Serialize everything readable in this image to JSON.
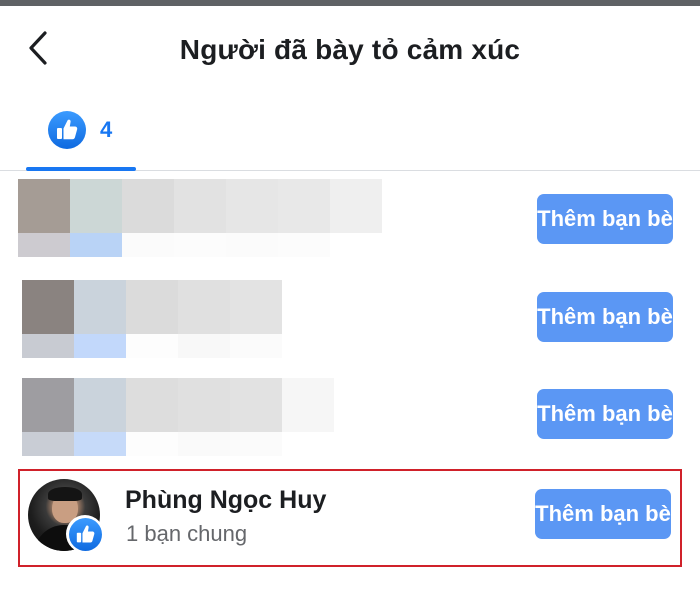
{
  "header": {
    "title": "Người đã bày tỏ cảm xúc",
    "back_icon": "arrow-back-icon"
  },
  "tabs": {
    "like_tab": {
      "icon": "like-icon",
      "count": "4",
      "active": true
    }
  },
  "list": {
    "rows": [
      {
        "name": "",
        "obscured": true,
        "action_label": "Thêm bạn bè"
      },
      {
        "name": "",
        "obscured": true,
        "action_label": "Thêm bạn bè"
      },
      {
        "name": "",
        "obscured": true,
        "action_label": "Thêm bạn bè"
      },
      {
        "name": "Phùng Ngọc Huy",
        "subtitle": "1 bạn chung",
        "reaction": "like",
        "highlighted": true,
        "action_label": "Thêm bạn bè"
      }
    ]
  },
  "colors": {
    "accent": "#1877f2",
    "button": "#5b97f4",
    "highlight_border": "#d0212a"
  }
}
